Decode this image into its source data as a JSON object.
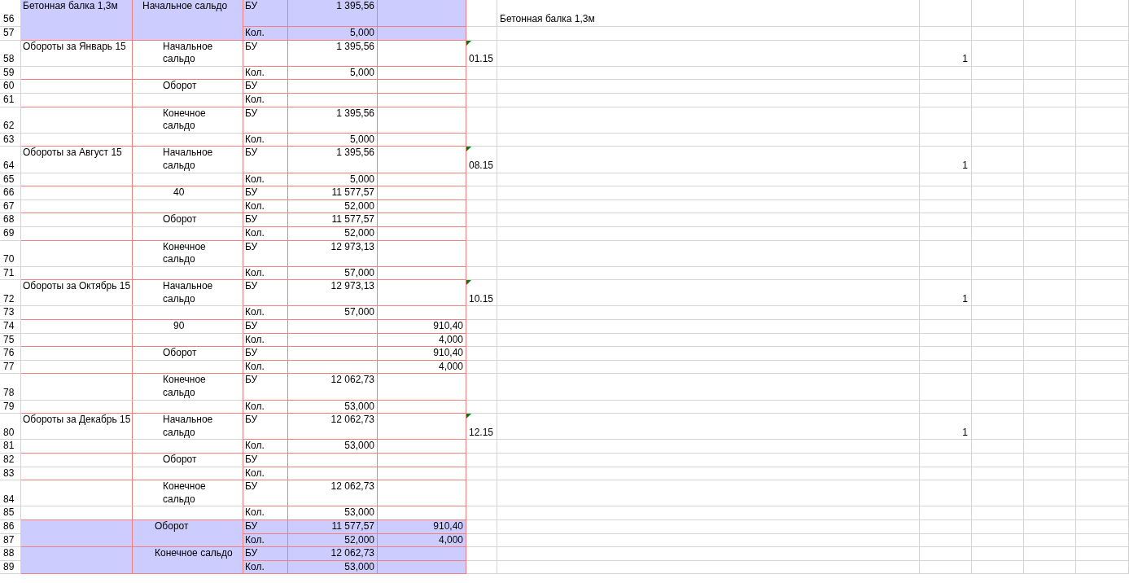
{
  "blocks": [
    {
      "kind": "header",
      "title": "Бетонная балка 1,3м",
      "label": "Начальное сальдо",
      "lines": [
        {
          "n": "56",
          "unit": "БУ",
          "debit": "1 395,56",
          "column_g": "Бетонная балка 1,3м"
        },
        {
          "n": "57",
          "unit": "Кол.",
          "debit": "5,000"
        }
      ]
    },
    {
      "kind": "period",
      "title": "Обороты за Январь 15",
      "label": "Начальное сальдо",
      "lines": [
        {
          "n": "58",
          "unit": "БУ",
          "debit": "1 395,56",
          "column_f": "01.15",
          "flag": true,
          "column_h": "1"
        },
        {
          "n": "59",
          "unit": "Кол.",
          "debit": "5,000"
        }
      ]
    },
    {
      "kind": "sub",
      "label": "Оборот",
      "lines": [
        {
          "n": "60",
          "unit": "БУ"
        },
        {
          "n": "61",
          "unit": "Кол."
        }
      ]
    },
    {
      "kind": "sub",
      "label": "Конечное сальдо",
      "lines": [
        {
          "n": "62",
          "unit": "БУ",
          "debit": "1 395,56"
        },
        {
          "n": "63",
          "unit": "Кол.",
          "debit": "5,000"
        }
      ]
    },
    {
      "kind": "period",
      "title": "Обороты за Август 15",
      "label": "Начальное сальдо",
      "lines": [
        {
          "n": "64",
          "unit": "БУ",
          "debit": "1 395,56",
          "column_f": "08.15",
          "flag": true,
          "column_h": "1"
        },
        {
          "n": "65",
          "unit": "Кол.",
          "debit": "5,000"
        }
      ]
    },
    {
      "kind": "account",
      "label": "40",
      "lines": [
        {
          "n": "66",
          "unit": "БУ",
          "debit": "11 577,57"
        },
        {
          "n": "67",
          "unit": "Кол.",
          "debit": "52,000"
        }
      ]
    },
    {
      "kind": "sub",
      "label": "Оборот",
      "lines": [
        {
          "n": "68",
          "unit": "БУ",
          "debit": "11 577,57"
        },
        {
          "n": "69",
          "unit": "Кол.",
          "debit": "52,000"
        }
      ]
    },
    {
      "kind": "sub",
      "label": "Конечное сальдо",
      "lines": [
        {
          "n": "70",
          "unit": "БУ",
          "debit": "12 973,13"
        },
        {
          "n": "71",
          "unit": "Кол.",
          "debit": "57,000"
        }
      ]
    },
    {
      "kind": "period",
      "title": "Обороты за Октябрь 15",
      "label": "Начальное сальдо",
      "lines": [
        {
          "n": "72",
          "unit": "БУ",
          "debit": "12 973,13",
          "column_f": "10.15",
          "flag": true,
          "column_h": "1"
        },
        {
          "n": "73",
          "unit": "Кол.",
          "debit": "57,000"
        }
      ]
    },
    {
      "kind": "account",
      "label": "90",
      "lines": [
        {
          "n": "74",
          "unit": "БУ",
          "credit": "910,40"
        },
        {
          "n": "75",
          "unit": "Кол.",
          "credit": "4,000"
        }
      ]
    },
    {
      "kind": "sub",
      "label": "Оборот",
      "lines": [
        {
          "n": "76",
          "unit": "БУ",
          "credit": "910,40"
        },
        {
          "n": "77",
          "unit": "Кол.",
          "credit": "4,000"
        }
      ]
    },
    {
      "kind": "sub",
      "label": "Конечное сальдо",
      "lines": [
        {
          "n": "78",
          "unit": "БУ",
          "debit": "12 062,73"
        },
        {
          "n": "79",
          "unit": "Кол.",
          "debit": "53,000"
        }
      ]
    },
    {
      "kind": "period",
      "title": "Обороты за Декабрь 15",
      "label": "Начальное сальдо",
      "lines": [
        {
          "n": "80",
          "unit": "БУ",
          "debit": "12 062,73",
          "column_f": "12.15",
          "flag": true,
          "column_h": "1"
        },
        {
          "n": "81",
          "unit": "Кол.",
          "debit": "53,000"
        }
      ]
    },
    {
      "kind": "sub",
      "label": "Оборот",
      "lines": [
        {
          "n": "82",
          "unit": "БУ"
        },
        {
          "n": "83",
          "unit": "Кол."
        }
      ]
    },
    {
      "kind": "sub",
      "label": "Конечное сальдо",
      "lines": [
        {
          "n": "84",
          "unit": "БУ",
          "debit": "12 062,73"
        },
        {
          "n": "85",
          "unit": "Кол.",
          "debit": "53,000"
        }
      ]
    },
    {
      "kind": "total",
      "label": "Оборот",
      "lines": [
        {
          "n": "86",
          "unit": "БУ",
          "debit": "11 577,57",
          "credit": "910,40"
        },
        {
          "n": "87",
          "unit": "Кол.",
          "debit": "52,000",
          "credit": "4,000"
        }
      ]
    },
    {
      "kind": "total",
      "label": "Конечное сальдо",
      "lines": [
        {
          "n": "88",
          "unit": "БУ",
          "debit": "12 062,73"
        },
        {
          "n": "89",
          "unit": "Кол.",
          "debit": "53,000"
        }
      ]
    }
  ]
}
